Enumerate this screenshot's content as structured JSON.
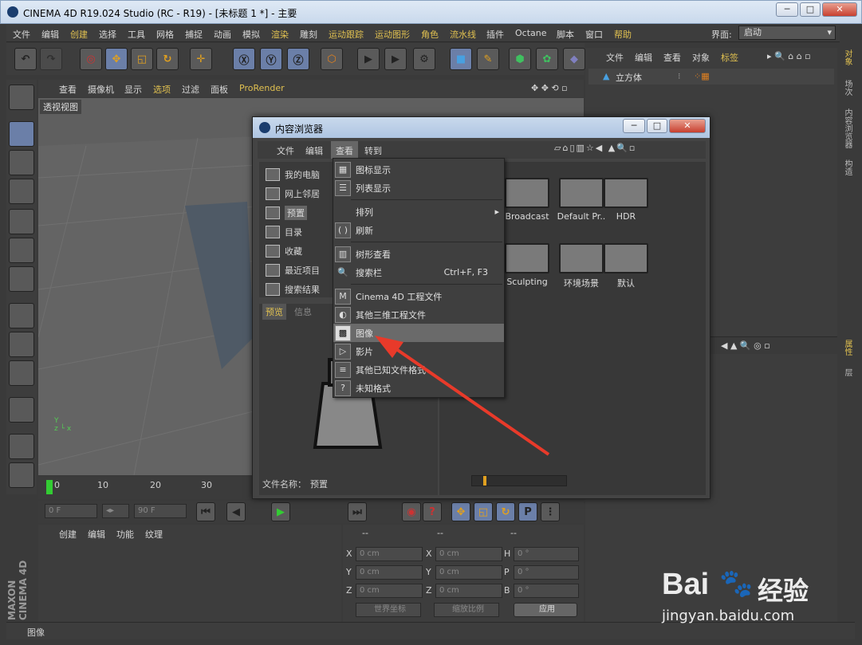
{
  "window": {
    "title": "CINEMA 4D R19.024 Studio (RC - R19) - [未标题 1 *] - 主要",
    "controls": [
      "─",
      "□",
      "✕"
    ]
  },
  "menubar": {
    "items": [
      "文件",
      "编辑",
      "创建",
      "选择",
      "工具",
      "网格",
      "捕捉",
      "动画",
      "模拟",
      "渲染",
      "雕刻",
      "运动跟踪",
      "运动图形",
      "角色",
      "流水线",
      "插件",
      "Octane",
      "脚本",
      "窗口",
      "帮助"
    ],
    "layout_label": "界面:",
    "layout_value": "启动"
  },
  "viewport": {
    "menu": [
      "查看",
      "摄像机",
      "显示",
      "选项",
      "过滤",
      "面板",
      "ProRender"
    ],
    "name": "透视视图"
  },
  "timeline": {
    "ticks": [
      "0",
      "10",
      "20",
      "30"
    ],
    "start": "0 F",
    "end": "90 F"
  },
  "material": {
    "menu": [
      "创建",
      "编辑",
      "功能",
      "纹理"
    ]
  },
  "coords": {
    "headers": [
      "--",
      "--",
      "--"
    ],
    "rows": [
      {
        "a": "X",
        "av": "0 cm",
        "b": "X",
        "bv": "0 cm",
        "c": "H",
        "cv": "0 °"
      },
      {
        "a": "Y",
        "av": "0 cm",
        "b": "Y",
        "bv": "0 cm",
        "c": "P",
        "cv": "0 °"
      },
      {
        "a": "Z",
        "av": "0 cm",
        "b": "Z",
        "bv": "0 cm",
        "c": "B",
        "cv": "0 °"
      }
    ],
    "world": "世界坐标",
    "scale": "缩放比例",
    "apply": "应用"
  },
  "objmgr": {
    "menu": [
      "文件",
      "编辑",
      "查看",
      "对象",
      "标签"
    ],
    "object": "立方体"
  },
  "vtabs": [
    "对象",
    "场次",
    "内容浏览器",
    "构造",
    "属性",
    "层"
  ],
  "status": "图像",
  "dialog": {
    "title": "内容浏览器",
    "menu": [
      "文件",
      "编辑",
      "查看",
      "转到"
    ],
    "tree": [
      "我的电脑",
      "网上邻居",
      "预置",
      "目录",
      "收藏",
      "最近项目",
      "搜索结果"
    ],
    "tabs": [
      "预览",
      "信息"
    ],
    "filename_label": "文件名称：",
    "filename_value": "预置",
    "folders": [
      "Broadcast",
      "Default Pr..",
      "HDR",
      "Sculpting",
      "环境场景",
      "默认"
    ]
  },
  "dropdown": {
    "items": [
      {
        "label": "图标显示",
        "icon": "grid-icon"
      },
      {
        "label": "列表显示",
        "icon": "list-icon"
      },
      {
        "label": "排列",
        "icon": "",
        "sub": "▸"
      },
      {
        "label": "刷新",
        "icon": "refresh-icon"
      },
      {
        "label": "树形查看",
        "icon": "tree-icon"
      },
      {
        "label": "搜索栏",
        "icon": "search-icon",
        "shortcut": "Ctrl+F, F3"
      },
      {
        "label": "Cinema 4D 工程文件",
        "icon": "c4d-file-icon"
      },
      {
        "label": "其他三维工程文件",
        "icon": "3d-file-icon"
      },
      {
        "label": "图像",
        "icon": "image-icon"
      },
      {
        "label": "影片",
        "icon": "movie-icon"
      },
      {
        "label": "其他已知文件格式",
        "icon": "file-icon"
      },
      {
        "label": "未知格式",
        "icon": "unknown-icon"
      }
    ]
  },
  "watermark": {
    "brand": "Bai",
    "brand2": "经验",
    "url": "jingyan.baidu.com"
  },
  "logo": {
    "l1": "MAXON",
    "l2": "CINEMA 4D"
  },
  "colors": {
    "accent": "#e0c050",
    "arrow": "#e83a2a"
  }
}
